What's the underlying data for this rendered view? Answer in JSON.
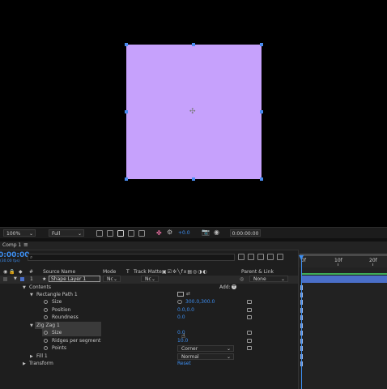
{
  "viewer": {
    "shape_color": "#c6a1fc"
  },
  "toolbar": {
    "zoom": "100%",
    "resolution": "Full",
    "exposure": "+0.0",
    "time": "0:00:00:00"
  },
  "panel": {
    "tab_label": "Comp 1",
    "menu_glyph": "≡",
    "timecode": "0:00:00",
    "fps": "(30.00 fps)",
    "search_icon": "⌕"
  },
  "columns": {
    "num": "#",
    "source": "Source Name",
    "mode": "Mode",
    "t": "T",
    "track_matte": "Track Matte",
    "parent": "Parent & Link"
  },
  "layer": {
    "index": "1",
    "name": "Shape Layer 1",
    "mode": "Nc",
    "matte": "Nc",
    "parent": "None"
  },
  "rows": {
    "contents": "Contents",
    "add_label": "Add:",
    "rect_path": "Rectangle Path 1",
    "size": "Size",
    "size_value": "300.0,300.0",
    "position": "Position",
    "position_value": "0.0,0.0",
    "roundness": "Roundness",
    "roundness_value": "0.0",
    "zigzag": "Zig Zag 1",
    "zz_size": "Size",
    "zz_size_value": "0.0",
    "ridges": "Ridges per segment",
    "ridges_value": "10.0",
    "points": "Points",
    "points_value": "Corner",
    "fill": "Fill 1",
    "fill_mode": "Normal",
    "transform": "Transform",
    "reset": "Reset"
  },
  "timeline": {
    "start": "0f",
    "mark1": "10f",
    "mark2": "20f"
  },
  "colors": {
    "accent": "#3d8ef0",
    "layer_bar": "#4a6fc9"
  }
}
